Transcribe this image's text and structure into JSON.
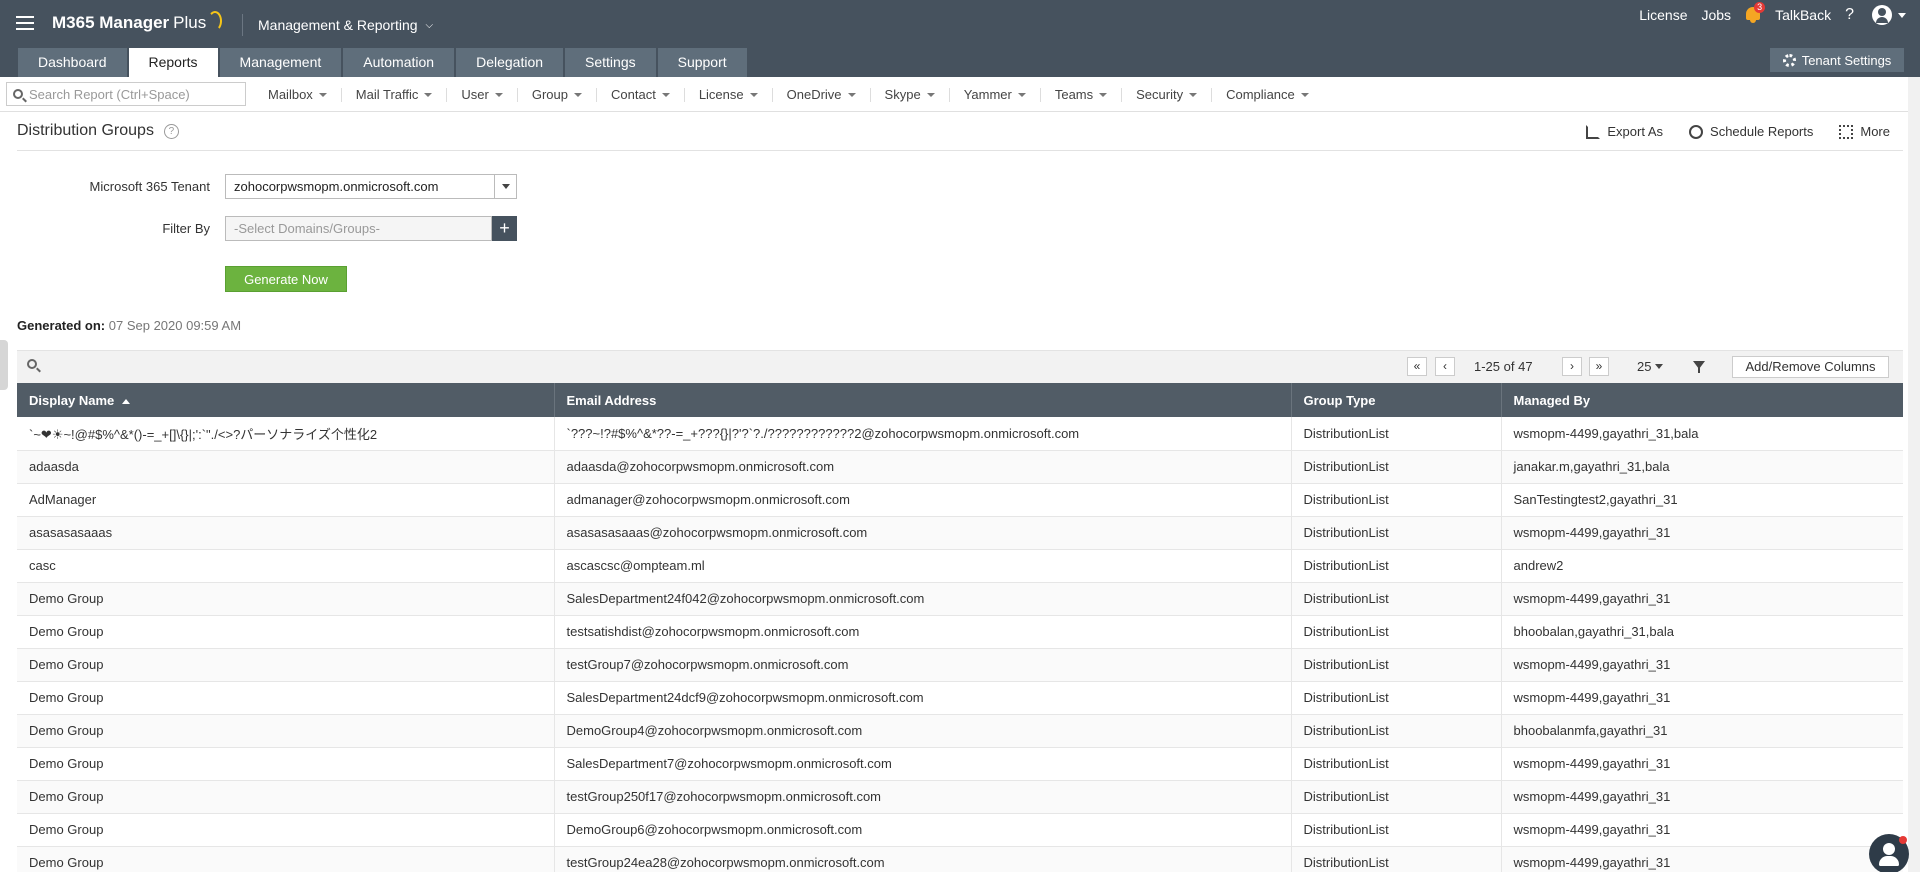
{
  "header": {
    "app_name": "M365 Manager",
    "app_suffix": "Plus",
    "product_switch": "Management & Reporting",
    "links": {
      "license": "License",
      "jobs": "Jobs",
      "talkback": "TalkBack",
      "help": "?"
    },
    "notification_count": "3",
    "tenant_settings": "Tenant Settings",
    "accent": "#f5a623"
  },
  "tabs": [
    "Dashboard",
    "Reports",
    "Management",
    "Automation",
    "Delegation",
    "Settings",
    "Support"
  ],
  "active_tab": "Reports",
  "subnav": {
    "search_placeholder": "Search Report (Ctrl+Space)",
    "menus": [
      "Mailbox",
      "Mail Traffic",
      "User",
      "Group",
      "Contact",
      "License",
      "OneDrive",
      "Skype",
      "Yammer",
      "Teams",
      "Security",
      "Compliance"
    ]
  },
  "page": {
    "title": "Distribution Groups",
    "help": "?",
    "actions": {
      "export": "Export As",
      "schedule": "Schedule Reports",
      "more": "More"
    }
  },
  "form": {
    "tenant_label": "Microsoft 365 Tenant",
    "tenant_value": "zohocorpwsmopm.onmicrosoft.com",
    "filter_label": "Filter By",
    "filter_placeholder": "-Select Domains/Groups-",
    "plus": "+",
    "generate": "Generate Now",
    "generate_color": "#6cb33f"
  },
  "generated": {
    "label": "Generated on:",
    "value": "07 Sep 2020 09:59 AM"
  },
  "grid": {
    "paging": "1-25 of 47",
    "per_page": "25",
    "add_remove": "Add/Remove Columns",
    "nav": {
      "first": "«",
      "prev": "‹",
      "next": "›",
      "last": "»"
    },
    "columns": [
      "Display Name",
      "Email Address",
      "Group Type",
      "Managed By"
    ],
    "rows": [
      [
        "`~❤☀~!@#$%^&*()-=_+[]\\{}|;':`\"./<>?パーソナライズ个性化2",
        "`???~!?#$%^&*??-=_+???{}|?'?`?./????????????2@zohocorpwsmopm.onmicrosoft.com",
        "DistributionList",
        "wsmopm-4499,gayathri_31,bala"
      ],
      [
        "adaasda",
        "adaasda@zohocorpwsmopm.onmicrosoft.com",
        "DistributionList",
        "janakar.m,gayathri_31,bala"
      ],
      [
        "AdManager",
        "admanager@zohocorpwsmopm.onmicrosoft.com",
        "DistributionList",
        "SanTestingtest2,gayathri_31"
      ],
      [
        "asasasasaaas",
        "asasasasaaas@zohocorpwsmopm.onmicrosoft.com",
        "DistributionList",
        "wsmopm-4499,gayathri_31"
      ],
      [
        "casc",
        "ascascsc@ompteam.ml",
        "DistributionList",
        "andrew2"
      ],
      [
        "Demo Group",
        "SalesDepartment24f042@zohocorpwsmopm.onmicrosoft.com",
        "DistributionList",
        "wsmopm-4499,gayathri_31"
      ],
      [
        "Demo Group",
        "testsatishdist@zohocorpwsmopm.onmicrosoft.com",
        "DistributionList",
        "bhoobalan,gayathri_31,bala"
      ],
      [
        "Demo Group",
        "testGroup7@zohocorpwsmopm.onmicrosoft.com",
        "DistributionList",
        "wsmopm-4499,gayathri_31"
      ],
      [
        "Demo Group",
        "SalesDepartment24dcf9@zohocorpwsmopm.onmicrosoft.com",
        "DistributionList",
        "wsmopm-4499,gayathri_31"
      ],
      [
        "Demo Group",
        "DemoGroup4@zohocorpwsmopm.onmicrosoft.com",
        "DistributionList",
        "bhoobalanmfa,gayathri_31"
      ],
      [
        "Demo Group",
        "SalesDepartment7@zohocorpwsmopm.onmicrosoft.com",
        "DistributionList",
        "wsmopm-4499,gayathri_31"
      ],
      [
        "Demo Group",
        "testGroup250f17@zohocorpwsmopm.onmicrosoft.com",
        "DistributionList",
        "wsmopm-4499,gayathri_31"
      ],
      [
        "Demo Group",
        "DemoGroup6@zohocorpwsmopm.onmicrosoft.com",
        "DistributionList",
        "wsmopm-4499,gayathri_31"
      ],
      [
        "Demo Group",
        "testGroup24ea28@zohocorpwsmopm.onmicrosoft.com",
        "DistributionList",
        "wsmopm-4499,gayathri_31"
      ]
    ]
  }
}
